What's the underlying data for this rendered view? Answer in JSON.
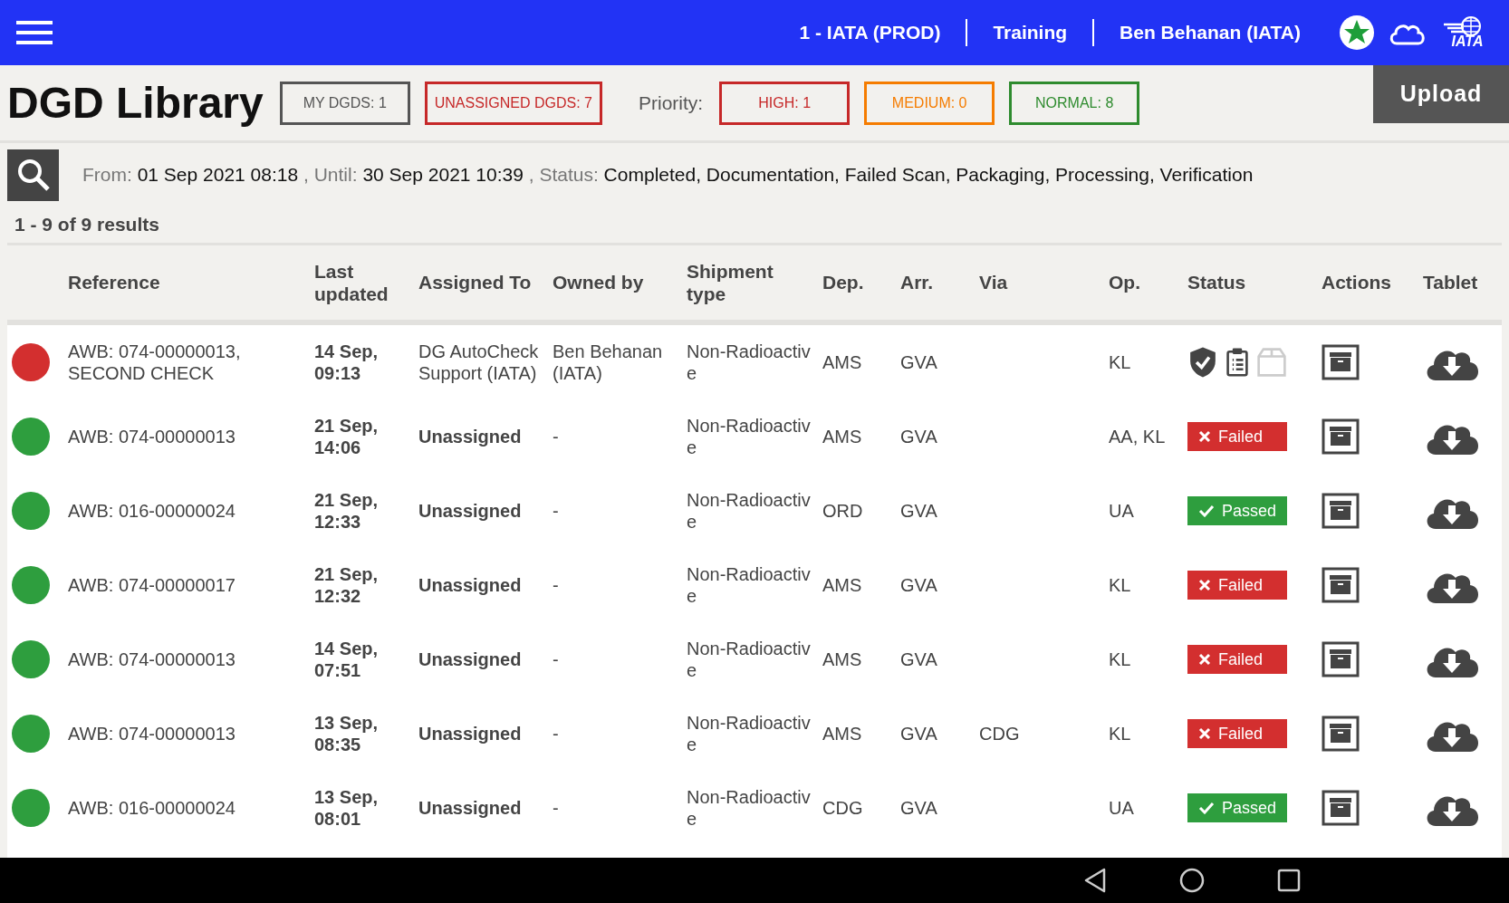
{
  "top_bar": {
    "organization": "1 - IATA (PROD)",
    "mode": "Training",
    "user": "Ben Behanan (IATA)",
    "logo_text": "IATA"
  },
  "header": {
    "title": "DGD Library",
    "counters": [
      {
        "label": "MY DGDS: 1",
        "color": "#555555"
      },
      {
        "label": "UNASSIGNED DGDS: 7",
        "color": "#c62828"
      }
    ],
    "priority_label": "Priority:",
    "priorities": [
      {
        "label": "HIGH: 1",
        "color": "#c62828"
      },
      {
        "label": "MEDIUM: 0",
        "color": "#f57c00"
      },
      {
        "label": "NORMAL: 8",
        "color": "#2e8b2e"
      }
    ],
    "upload_button": "Upload"
  },
  "filters": [
    {
      "label": "From:",
      "value": "01 Sep 2021 08:18"
    },
    {
      "label": ", Until:",
      "value": "30 Sep 2021 10:39"
    },
    {
      "label": ", Status:",
      "value": "Completed, Documentation, Failed Scan, Packaging, Processing, Verification"
    }
  ],
  "results": "1 - 9 of 9 results",
  "table": {
    "columns": [
      "Reference",
      "Last updated",
      "Assigned To",
      "Owned by",
      "Shipment type",
      "Dep.",
      "Arr.",
      "Via",
      "Op.",
      "Status",
      "Actions",
      "Tablet"
    ],
    "rows": [
      {
        "color": "#d32f2f",
        "reference": "AWB: 074-00000013, SECOND CHECK",
        "updated": "14 Sep, 09:13",
        "assigned": "DG AutoCheck Support (IATA)",
        "assigned_bold": false,
        "owned": "Ben Behanan (IATA)",
        "shipment": "Non-Radioactive",
        "dep": "AMS",
        "arr": "GVA",
        "via": "",
        "op": "KL",
        "status": {
          "kind": "steps",
          "steps": [
            {
              "kind": "scan",
              "done": true
            },
            {
              "kind": "documentation",
              "done": true
            },
            {
              "kind": "packaging",
              "done": false
            }
          ]
        }
      },
      {
        "color": "#2e9e3e",
        "reference": "AWB: 074-00000013",
        "updated": "21 Sep, 14:06",
        "assigned": "Unassigned",
        "assigned_bold": true,
        "owned": "-",
        "shipment": "Non-Radioactive",
        "dep": "AMS",
        "arr": "GVA",
        "via": "",
        "op": "AA, KL",
        "status": {
          "kind": "failed",
          "label": "Failed"
        }
      },
      {
        "color": "#2e9e3e",
        "reference": "AWB: 016-00000024",
        "updated": "21 Sep, 12:33",
        "assigned": "Unassigned",
        "assigned_bold": true,
        "owned": "-",
        "shipment": "Non-Radioactive",
        "dep": "ORD",
        "arr": "GVA",
        "via": "",
        "op": "UA",
        "status": {
          "kind": "passed",
          "label": "Passed"
        }
      },
      {
        "color": "#2e9e3e",
        "reference": "AWB: 074-00000017",
        "updated": "21 Sep, 12:32",
        "assigned": "Unassigned",
        "assigned_bold": true,
        "owned": "-",
        "shipment": "Non-Radioactive",
        "dep": "AMS",
        "arr": "GVA",
        "via": "",
        "op": "KL",
        "status": {
          "kind": "failed",
          "label": "Failed"
        }
      },
      {
        "color": "#2e9e3e",
        "reference": "AWB: 074-00000013",
        "updated": "14 Sep, 07:51",
        "assigned": "Unassigned",
        "assigned_bold": true,
        "owned": "-",
        "shipment": "Non-Radioactive",
        "dep": "AMS",
        "arr": "GVA",
        "via": "",
        "op": "KL",
        "status": {
          "kind": "failed",
          "label": "Failed"
        }
      },
      {
        "color": "#2e9e3e",
        "reference": "AWB: 074-00000013",
        "updated": "13 Sep, 08:35",
        "assigned": "Unassigned",
        "assigned_bold": true,
        "owned": "-",
        "shipment": "Non-Radioactive",
        "dep": "AMS",
        "arr": "GVA",
        "via": "CDG",
        "op": "KL",
        "status": {
          "kind": "failed",
          "label": "Failed"
        }
      },
      {
        "color": "#2e9e3e",
        "reference": "AWB: 016-00000024",
        "updated": "13 Sep, 08:01",
        "assigned": "Unassigned",
        "assigned_bold": true,
        "owned": "-",
        "shipment": "Non-Radioactive",
        "dep": "CDG",
        "arr": "GVA",
        "via": "",
        "op": "UA",
        "status": {
          "kind": "passed",
          "label": "Passed"
        }
      }
    ]
  }
}
